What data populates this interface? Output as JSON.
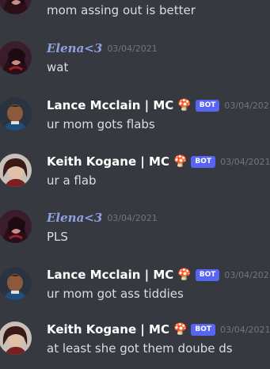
{
  "messages": [
    {
      "author": "",
      "date": "",
      "text": "mom assing out is better",
      "avatar": "elena"
    },
    {
      "author": "Elena<3",
      "date": "03/04/2021",
      "text": "wat",
      "avatar": "elena"
    },
    {
      "author": "Lance Mcclain | MC",
      "badge": "BOT",
      "date": "03/04/202",
      "text": "ur mom gots flabs",
      "avatar": "lance"
    },
    {
      "author": "Keith Kogane | MC",
      "badge": "BOT",
      "date": "03/04/2021",
      "text": "ur a flab",
      "avatar": "keith"
    },
    {
      "author": "Elena<3",
      "date": "03/04/2021",
      "text": "PLS",
      "avatar": "elena"
    },
    {
      "author": "Lance Mcclain | MC",
      "badge": "BOT",
      "date": "03/04/202",
      "text": "ur mom got ass tiddies",
      "avatar": "lance"
    },
    {
      "author": "Keith Kogane | MC",
      "badge": "BOT",
      "date": "03/04/2021",
      "text": "at least she got them doube ds",
      "avatar": "keith"
    }
  ],
  "icons": {
    "mushroom": "🍄"
  },
  "colors": {
    "background": "#36393f",
    "bot_badge": "#5865f2",
    "elena_name": "#8ea1e1"
  }
}
